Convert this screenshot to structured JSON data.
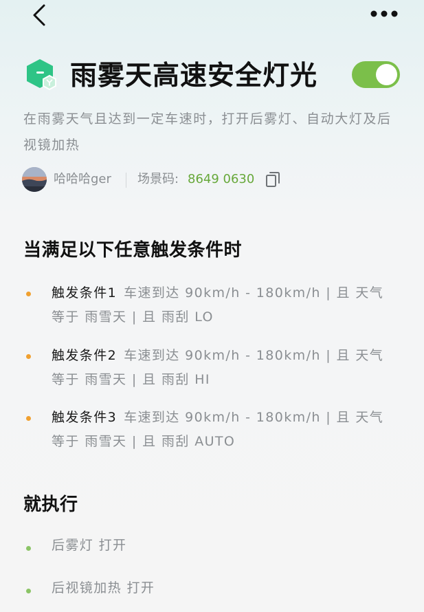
{
  "nav": {
    "back_icon": "chevron-left-icon",
    "more_icon": "more-horizontal-icon"
  },
  "header": {
    "icon": "scene-hexagon-icon",
    "title": "雨雾天高速安全灯光",
    "toggle_on": true,
    "description": "在雨雾天气且达到一定车速时，打开后雾灯、自动大灯及后视镜加热"
  },
  "author": {
    "avatar_icon": "user-avatar",
    "name": "哈哈哈ger",
    "scene_code_label": "场景码:",
    "scene_code_value": "8649 0630",
    "copy_icon": "copy-icon"
  },
  "triggers": {
    "heading": "当满足以下任意触发条件时",
    "items": [
      {
        "name": "触发条件1",
        "detail": "车速到达 90km/h - 180km/h | 且 天气 等于 雨雪天 | 且 雨刮 LO"
      },
      {
        "name": "触发条件2",
        "detail": "车速到达 90km/h - 180km/h | 且 天气 等于 雨雪天 | 且 雨刮 HI"
      },
      {
        "name": "触发条件3",
        "detail": "车速到达 90km/h - 180km/h | 且 天气 等于 雨雪天 | 且 雨刮 AUTO"
      }
    ]
  },
  "actions": {
    "heading": "就执行",
    "items": [
      {
        "text": "后雾灯 打开"
      },
      {
        "text": "后视镜加热 打开"
      }
    ]
  },
  "colors": {
    "accent_green": "#7bbf4a",
    "code_green": "#67a83a",
    "trigger_bullet": "#f0a030",
    "action_bullet": "#8bc466",
    "icon_green": "#2ec486",
    "muted_text": "#8a8e92"
  }
}
